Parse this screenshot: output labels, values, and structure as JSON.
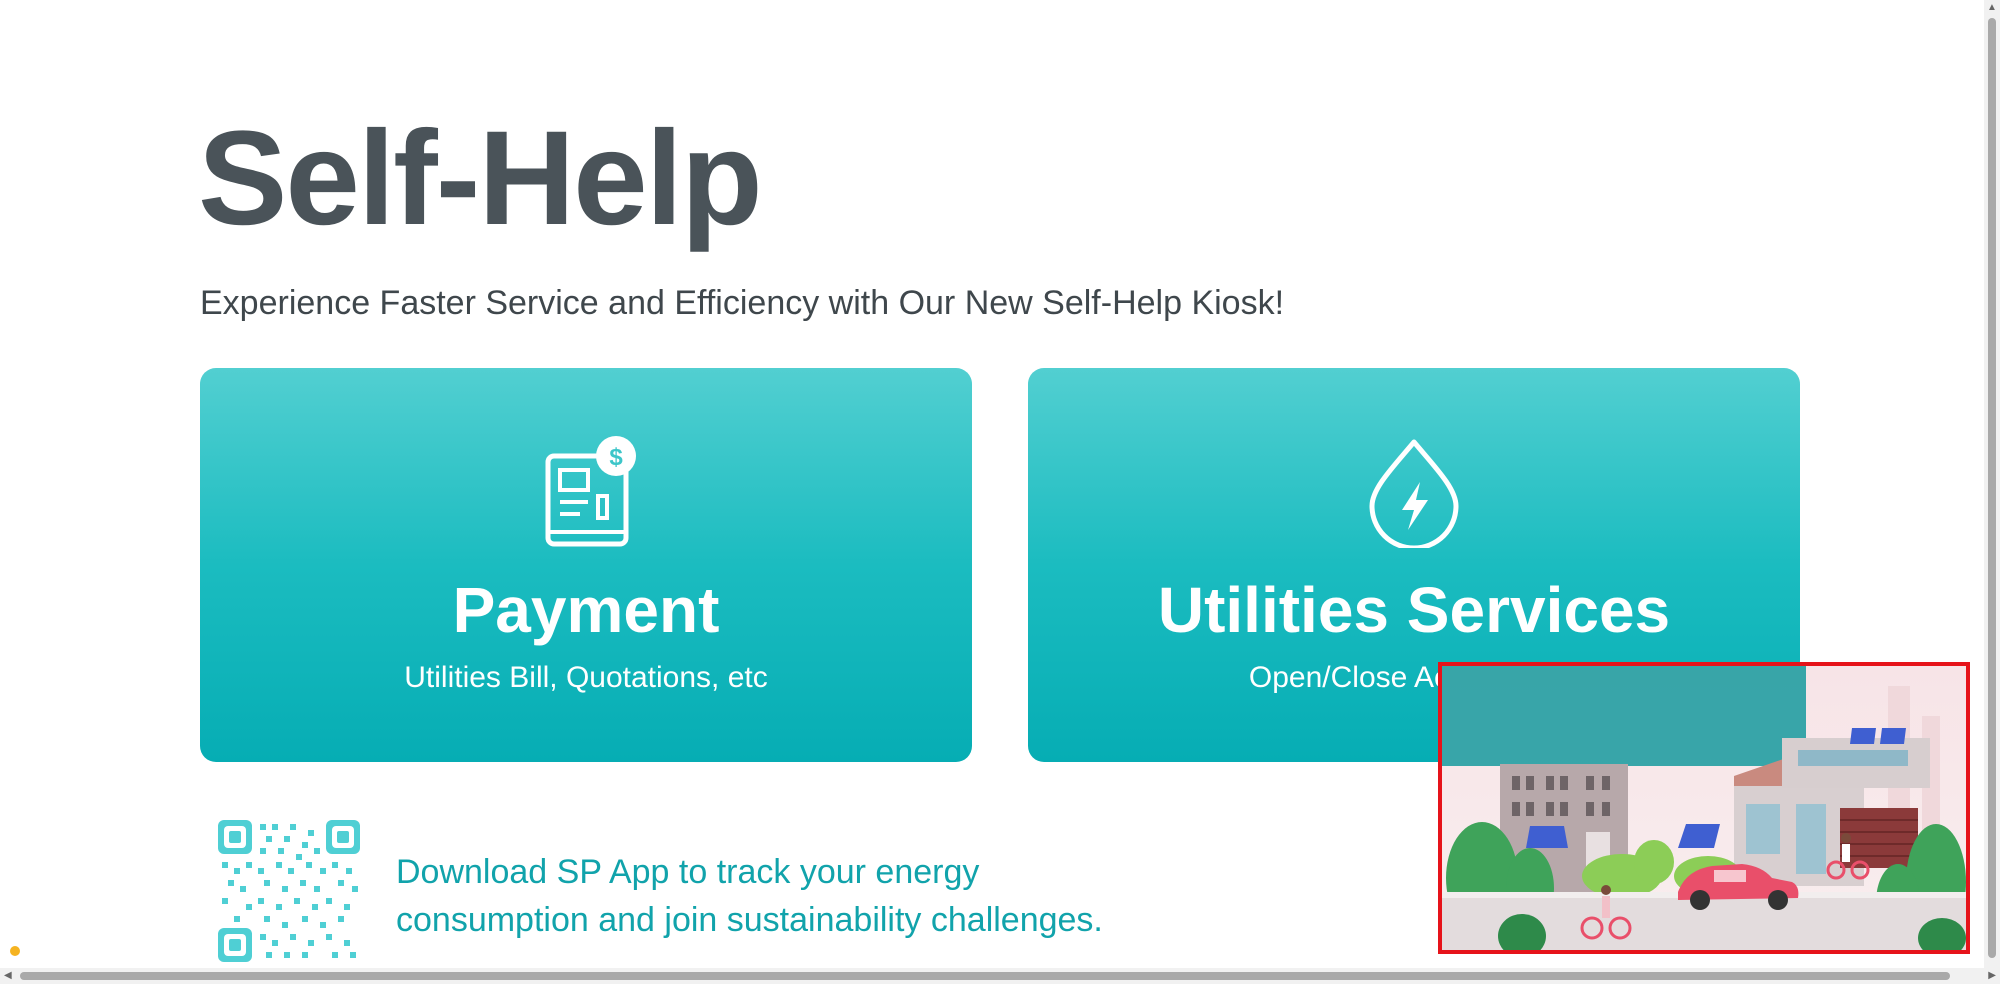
{
  "page": {
    "title": "Self-Help",
    "subtitle": "Experience Faster Service and Efficiency with Our New Self-Help Kiosk!"
  },
  "cards": [
    {
      "title": "Payment",
      "subtitle": "Utilities Bill, Quotations, etc",
      "icon": "bill-dollar-icon"
    },
    {
      "title": "Utilities Services",
      "subtitle": "Open/Close Account, etc",
      "icon": "energy-drop-icon"
    }
  ],
  "app_promo": {
    "text_line1": "Download SP App to track your energy",
    "text_line2": "consumption and join sustainability challenges.",
    "qr_icon": "qr-code-icon"
  },
  "colors": {
    "heading": "#4a5359",
    "card_gradient_top": "#52cfd1",
    "card_gradient_bottom": "#06adb4",
    "promo_text": "#11a3ab",
    "highlight_box": "#e6131a"
  },
  "illustration": {
    "icon": "sustainable-city-illustration"
  }
}
